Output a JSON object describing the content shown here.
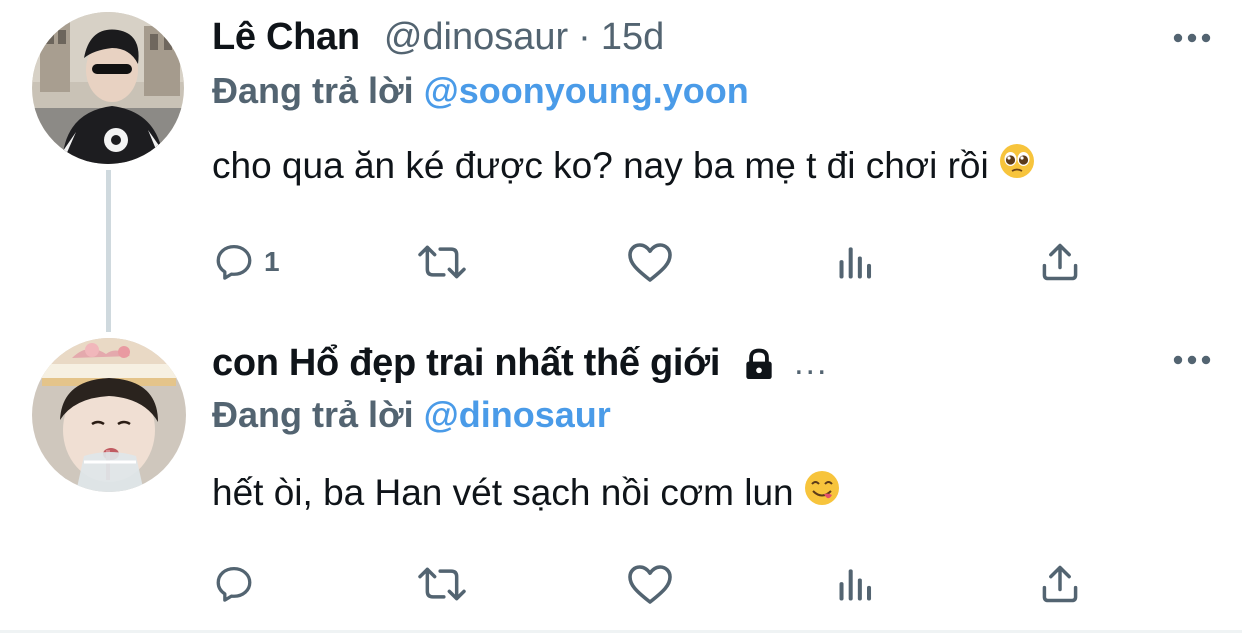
{
  "tweets": [
    {
      "name": "Lê Chan",
      "handle": "@dinosaur",
      "separator": "·",
      "time": "15d",
      "reply_prefix": "Đang trả lời",
      "reply_mention": "@soonyoung.yoon",
      "text": "cho qua ăn ké được ko? nay ba mẹ t đi chơi rồi",
      "emoji": "pleading-face",
      "reply_count": "1",
      "avatar": "profile-photo"
    },
    {
      "name": "con Hổ đẹp trai nhất thế giới",
      "locked": true,
      "name_tail": "...",
      "reply_prefix": "Đang trả lời",
      "reply_mention": "@dinosaur",
      "text": "hết òi, ba Han vét sạch nồi cơm lun",
      "emoji": "yum-face",
      "reply_count": "",
      "avatar": "profile-photo"
    }
  ],
  "icons": {
    "more": "more-horizontal-icon",
    "reply": "reply-icon",
    "retweet": "retweet-icon",
    "like": "like-icon",
    "views": "views-icon",
    "share": "share-icon",
    "lock": "lock-icon"
  },
  "colors": {
    "text": "#0f1419",
    "secondary": "#536471",
    "mention": "#4a9be8",
    "thread_line": "#cfd9de"
  }
}
